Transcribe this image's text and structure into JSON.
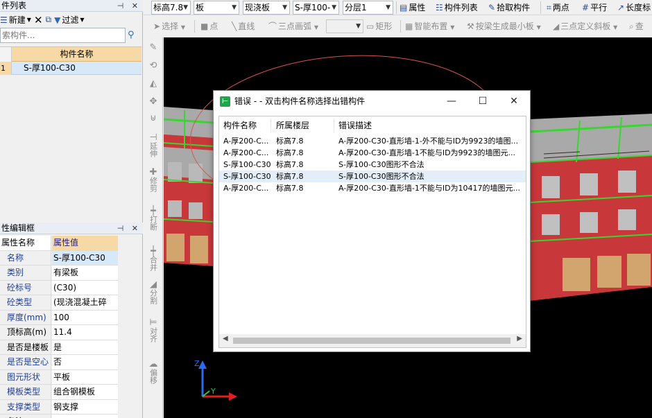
{
  "left_panel": {
    "component_list_title": "件列表",
    "toolbar": {
      "new_label": "新建",
      "delete_icon": "close-icon",
      "copy_icon": "copy-icon",
      "filter_label": "过滤"
    },
    "search": {
      "placeholder": "索构件..."
    },
    "component_table": {
      "header": "构件名称",
      "rows": [
        {
          "index": "1",
          "name": "S-厚100-C30"
        }
      ]
    },
    "properties_title": "性编辑框",
    "properties": {
      "header_key": "属性名称",
      "header_value": "属性值",
      "rows": [
        {
          "key": "名称",
          "value": "S-厚100-C30",
          "style": "blue"
        },
        {
          "key": "类别",
          "value": "有梁板",
          "style": "blue"
        },
        {
          "key": "砼标号",
          "value": "(C30)",
          "style": "blue"
        },
        {
          "key": "砼类型",
          "value": "(现浇混凝土碎",
          "style": "blue"
        },
        {
          "key": "厚度(mm)",
          "value": "100",
          "style": "blue"
        },
        {
          "key": "顶标高(m)",
          "value": "11.4",
          "style": "black"
        },
        {
          "key": "是否是楼板",
          "value": "是",
          "style": "black"
        },
        {
          "key": "是否是空心",
          "value": "否",
          "style": "blue"
        },
        {
          "key": "图元形状",
          "value": "平板",
          "style": "blue"
        },
        {
          "key": "模板类型",
          "value": "组合钢模板",
          "style": "blue"
        },
        {
          "key": "支撑类型",
          "value": "钢支撑",
          "style": "blue"
        },
        {
          "key": "备注",
          "value": "",
          "style": "black"
        }
      ]
    }
  },
  "top_toolbar": {
    "row1": {
      "floor_dropdown": "标高7.8",
      "type_dropdown": "板",
      "subtype_dropdown": "现浇板",
      "component_dropdown": "S-厚100-",
      "layer_dropdown": "分层1",
      "properties_label": "属性",
      "component_list_label": "构件列表",
      "pick_label": "拾取构件",
      "two_point_label": "两点",
      "parallel_label": "平行",
      "length_label": "长度标"
    },
    "row2": {
      "select_label": "选择",
      "point_label": "点",
      "line_label": "直线",
      "arc_label": "三点画弧",
      "rect_label": "矩形",
      "smart_layout_label": "智能布置",
      "beam_slab_label": "按梁生成最小板",
      "slope_label": "三点定义斜板",
      "query_label": "查"
    }
  },
  "vertical_tools": {
    "extend": "延伸",
    "trim": "修剪",
    "break": "打断",
    "merge": "合并",
    "split": "分割",
    "align": "对齐",
    "offset": "偏移"
  },
  "dialog": {
    "title": "错误 -  - 双击构件名称选择出错构件",
    "columns": [
      "构件名称",
      "所属楼层",
      "错误描述"
    ],
    "rows": [
      {
        "name": "A-厚200-C...",
        "floor": "标高7.8",
        "desc": "A-厚200-C30-直形墙-1-外不能与ID为9923的墙图...",
        "selected": false
      },
      {
        "name": "A-厚200-C...",
        "floor": "标高7.8",
        "desc": "A-厚200-C30-直形墙-1不能与ID为9923的墙图元...",
        "selected": false
      },
      {
        "name": "S-厚100-C30",
        "floor": "标高7.8",
        "desc": "S-厚100-C30图形不合法",
        "selected": false
      },
      {
        "name": "S-厚100-C30",
        "floor": "标高7.8",
        "desc": "S-厚100-C30图形不合法",
        "selected": true
      },
      {
        "name": "A-厚200-C...",
        "floor": "标高7.8",
        "desc": "A-厚200-C30-直形墙-1不能与ID为10417的墙图元...",
        "selected": false
      }
    ]
  },
  "axes": {
    "z": "Z",
    "y": "Y"
  },
  "colors": {
    "wall_red": "#c8373a",
    "slab_gray": "#9e9e9e",
    "beam_green": "#38d630",
    "window_tan": "#d2a56e",
    "annotation_red": "#d9534f",
    "highlight_row": "#d7e9f8"
  }
}
